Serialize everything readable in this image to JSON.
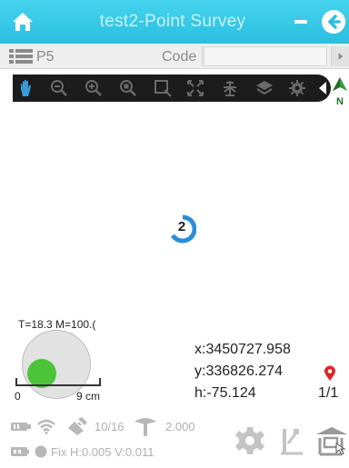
{
  "header": {
    "title": "test2-Point Survey",
    "icons": [
      "home-icon",
      "minimize-icon",
      "back-icon"
    ]
  },
  "pointbar": {
    "point_name": "P5",
    "code_label": "Code",
    "code_value": ""
  },
  "toolbar": {
    "tools": [
      "pan-hand-icon",
      "zoom-out-icon",
      "zoom-in-icon",
      "zoom-extent-icon",
      "select-icon",
      "fullscreen-icon",
      "measure-icon",
      "layers-icon",
      "settings-icon"
    ]
  },
  "map": {
    "marker_count": "2",
    "tolerance_text": "T=18.3 M=100.(",
    "scale_zero": "0",
    "scale_max": "9 cm",
    "coord_x": "x:3450727.958",
    "coord_y": "y:336826.274",
    "coord_h": "h:-75.124",
    "page_count": "1/1"
  },
  "status": {
    "satellites": "10/16",
    "height": "2.000",
    "fix_text": "Fix H:0.005 V:0.011"
  },
  "colors": {
    "titlebar": "#2bbfe0",
    "accent": "#2a8fd8",
    "fix_green": "#4dc33a",
    "pin_red": "#e02424"
  }
}
